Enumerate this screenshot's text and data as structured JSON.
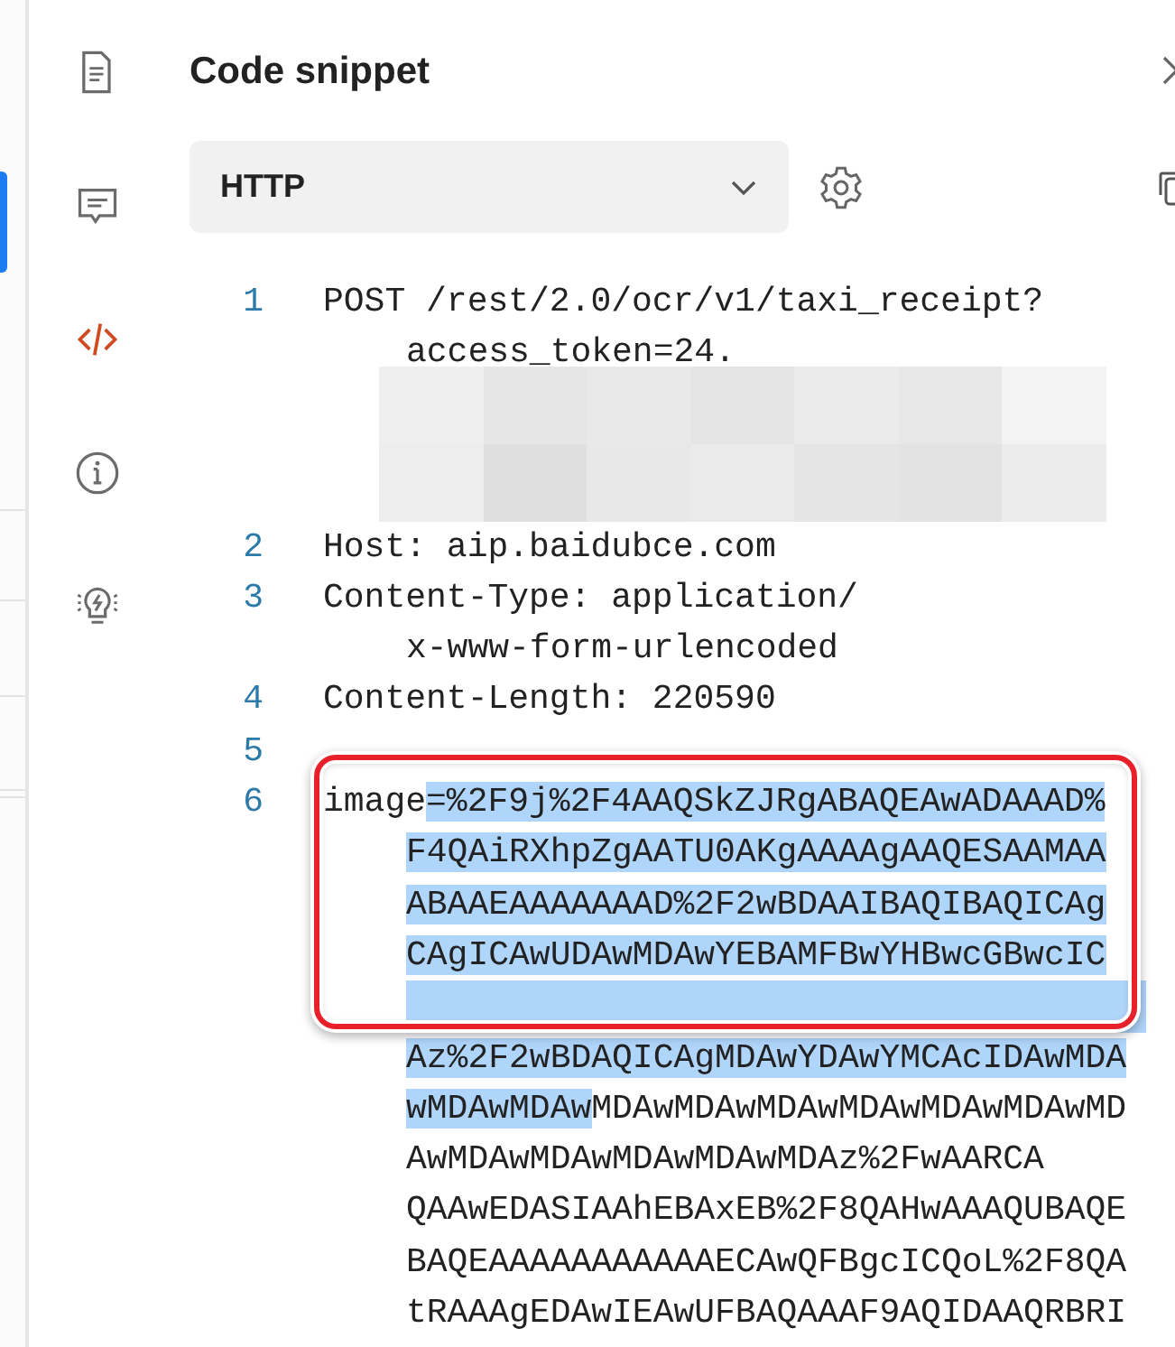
{
  "sidebar": {
    "items": [
      {
        "kind": "document",
        "selected": false
      },
      {
        "kind": "comment",
        "selected": false
      },
      {
        "kind": "code",
        "selected": true
      },
      {
        "kind": "info",
        "selected": false
      },
      {
        "kind": "bulb",
        "selected": false
      }
    ]
  },
  "panel": {
    "title": "Code snippet",
    "language": "HTTP"
  },
  "code": {
    "lines": [
      {
        "number": "1",
        "redacted": true,
        "rows": [
          [
            {
              "text": "POST /rest/2.0/ocr/v1/taxi_receipt?",
              "selected": false
            }
          ],
          [
            {
              "text": "access_token=24.",
              "selected": false
            }
          ]
        ]
      },
      {
        "number": "2",
        "redacted": false,
        "rows": [
          [
            {
              "text": "Host: aip.baidubce.com",
              "selected": false
            }
          ]
        ]
      },
      {
        "number": "3",
        "redacted": false,
        "rows": [
          [
            {
              "text": "Content-Type: application/",
              "selected": false
            }
          ],
          [
            {
              "text": "x-www-form-urlencoded",
              "selected": false
            }
          ]
        ]
      },
      {
        "number": "4",
        "redacted": false,
        "rows": [
          [
            {
              "text": "Content-Length: 220590",
              "selected": false
            }
          ]
        ]
      },
      {
        "number": "5",
        "redacted": false
      },
      {
        "number": "6",
        "redacted": false,
        "rows": [
          [
            {
              "text": "image",
              "selected": false
            },
            {
              "text": "=%2F9j%2F4AAQSkZJRgABAQEAwADAAAD%",
              "selected": true
            }
          ],
          [
            {
              "text": "F4QAiRXhpZgAATU0AKgAAAAgAAQESAAMAA",
              "selected": true
            }
          ],
          [
            {
              "text": "ABAAEAAAAAAAD%2F2wBDAAIBAQIBAQICAg",
              "selected": true
            }
          ],
          [
            {
              "text": "CAgICAwUDAwMDAwYEBAMFBwYHBwcGBwcIC",
              "selected": true
            }
          ],
          [
            {
              "selected": true
            }
          ],
          [
            {
              "text": "Az%2F2wBDAQICAgMDAwYDAwYMCAcIDAwMDA",
              "selected": true
            }
          ],
          [
            {
              "text": "wMDAwMDAw",
              "selected": true
            },
            {
              "text": "MDAwMDAwMDAwMDAwMDAwMDAwMD",
              "selected": false
            }
          ],
          [
            {
              "text": "AwMDAwMDAwMDAwMDAwMDAz%2FwAARCA",
              "selected": false
            }
          ],
          [
            {
              "text": "QAAwEDASIAAhEBAxEB%2F8QAHwAAAQUBAQE",
              "selected": false
            }
          ],
          [
            {
              "text": "BAQEAAAAAAAAAAAECAwQFBgcICQoL%2F8QA",
              "selected": false
            }
          ],
          [
            {
              "text": "tRAAAgEDAwIEAwUFBAQAAAF9AQIDAAQRBRI",
              "selected": false
            }
          ]
        ]
      }
    ]
  },
  "highlight_frame": {
    "kind": "rounded"
  }
}
